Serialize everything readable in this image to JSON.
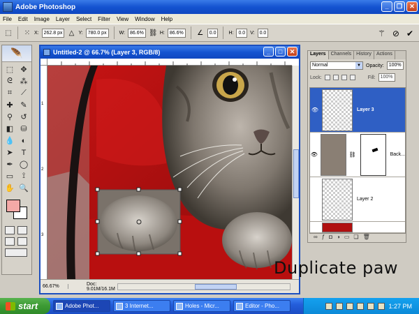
{
  "window": {
    "title": "Adobe Photoshop"
  },
  "menu": [
    "File",
    "Edit",
    "Image",
    "Layer",
    "Select",
    "Filter",
    "View",
    "Window",
    "Help"
  ],
  "options": {
    "x_label": "X:",
    "x_value": "262.8 px",
    "y_label": "Y:",
    "y_value": "780.0 px",
    "w_label": "W:",
    "w_value": "86.6%",
    "h_label": "H:",
    "h_value": "86.6%",
    "rot_value": "0.0",
    "hskew_label": "H:",
    "hskew_value": "0.0",
    "vskew_label": "V:",
    "vskew_value": "0.0"
  },
  "document": {
    "title": "Untitled-2 @ 66.7% (Layer 3, RGB/8)",
    "zoom": "66.67%",
    "doc_info": "Doc: 9.01M/16.1M",
    "ruler_marks_left": [
      "1",
      "2",
      "3"
    ]
  },
  "layers_panel": {
    "tabs": [
      "Layers",
      "Channels",
      "History",
      "Actions"
    ],
    "blend_mode": "Normal",
    "opacity_label": "Opacity:",
    "opacity": "100%",
    "lock_label": "Lock:",
    "fill_label": "Fill:",
    "fill": "100%",
    "layers": [
      {
        "name": "Layer 3",
        "selected": true
      },
      {
        "name": "Back...",
        "selected": false
      },
      {
        "name": "Layer 2",
        "selected": false
      }
    ]
  },
  "caption": "Duplicate paw",
  "taskbar": {
    "start": "start",
    "tasks": [
      "Adobe Phot...",
      "3 Internet...",
      "Holes - Micr...",
      "Editor - Pho..."
    ],
    "clock": "1:27 PM"
  },
  "colors": {
    "foreground": "#f4a9a7",
    "background": "#ffffff",
    "selection": "#2f5fc4"
  }
}
